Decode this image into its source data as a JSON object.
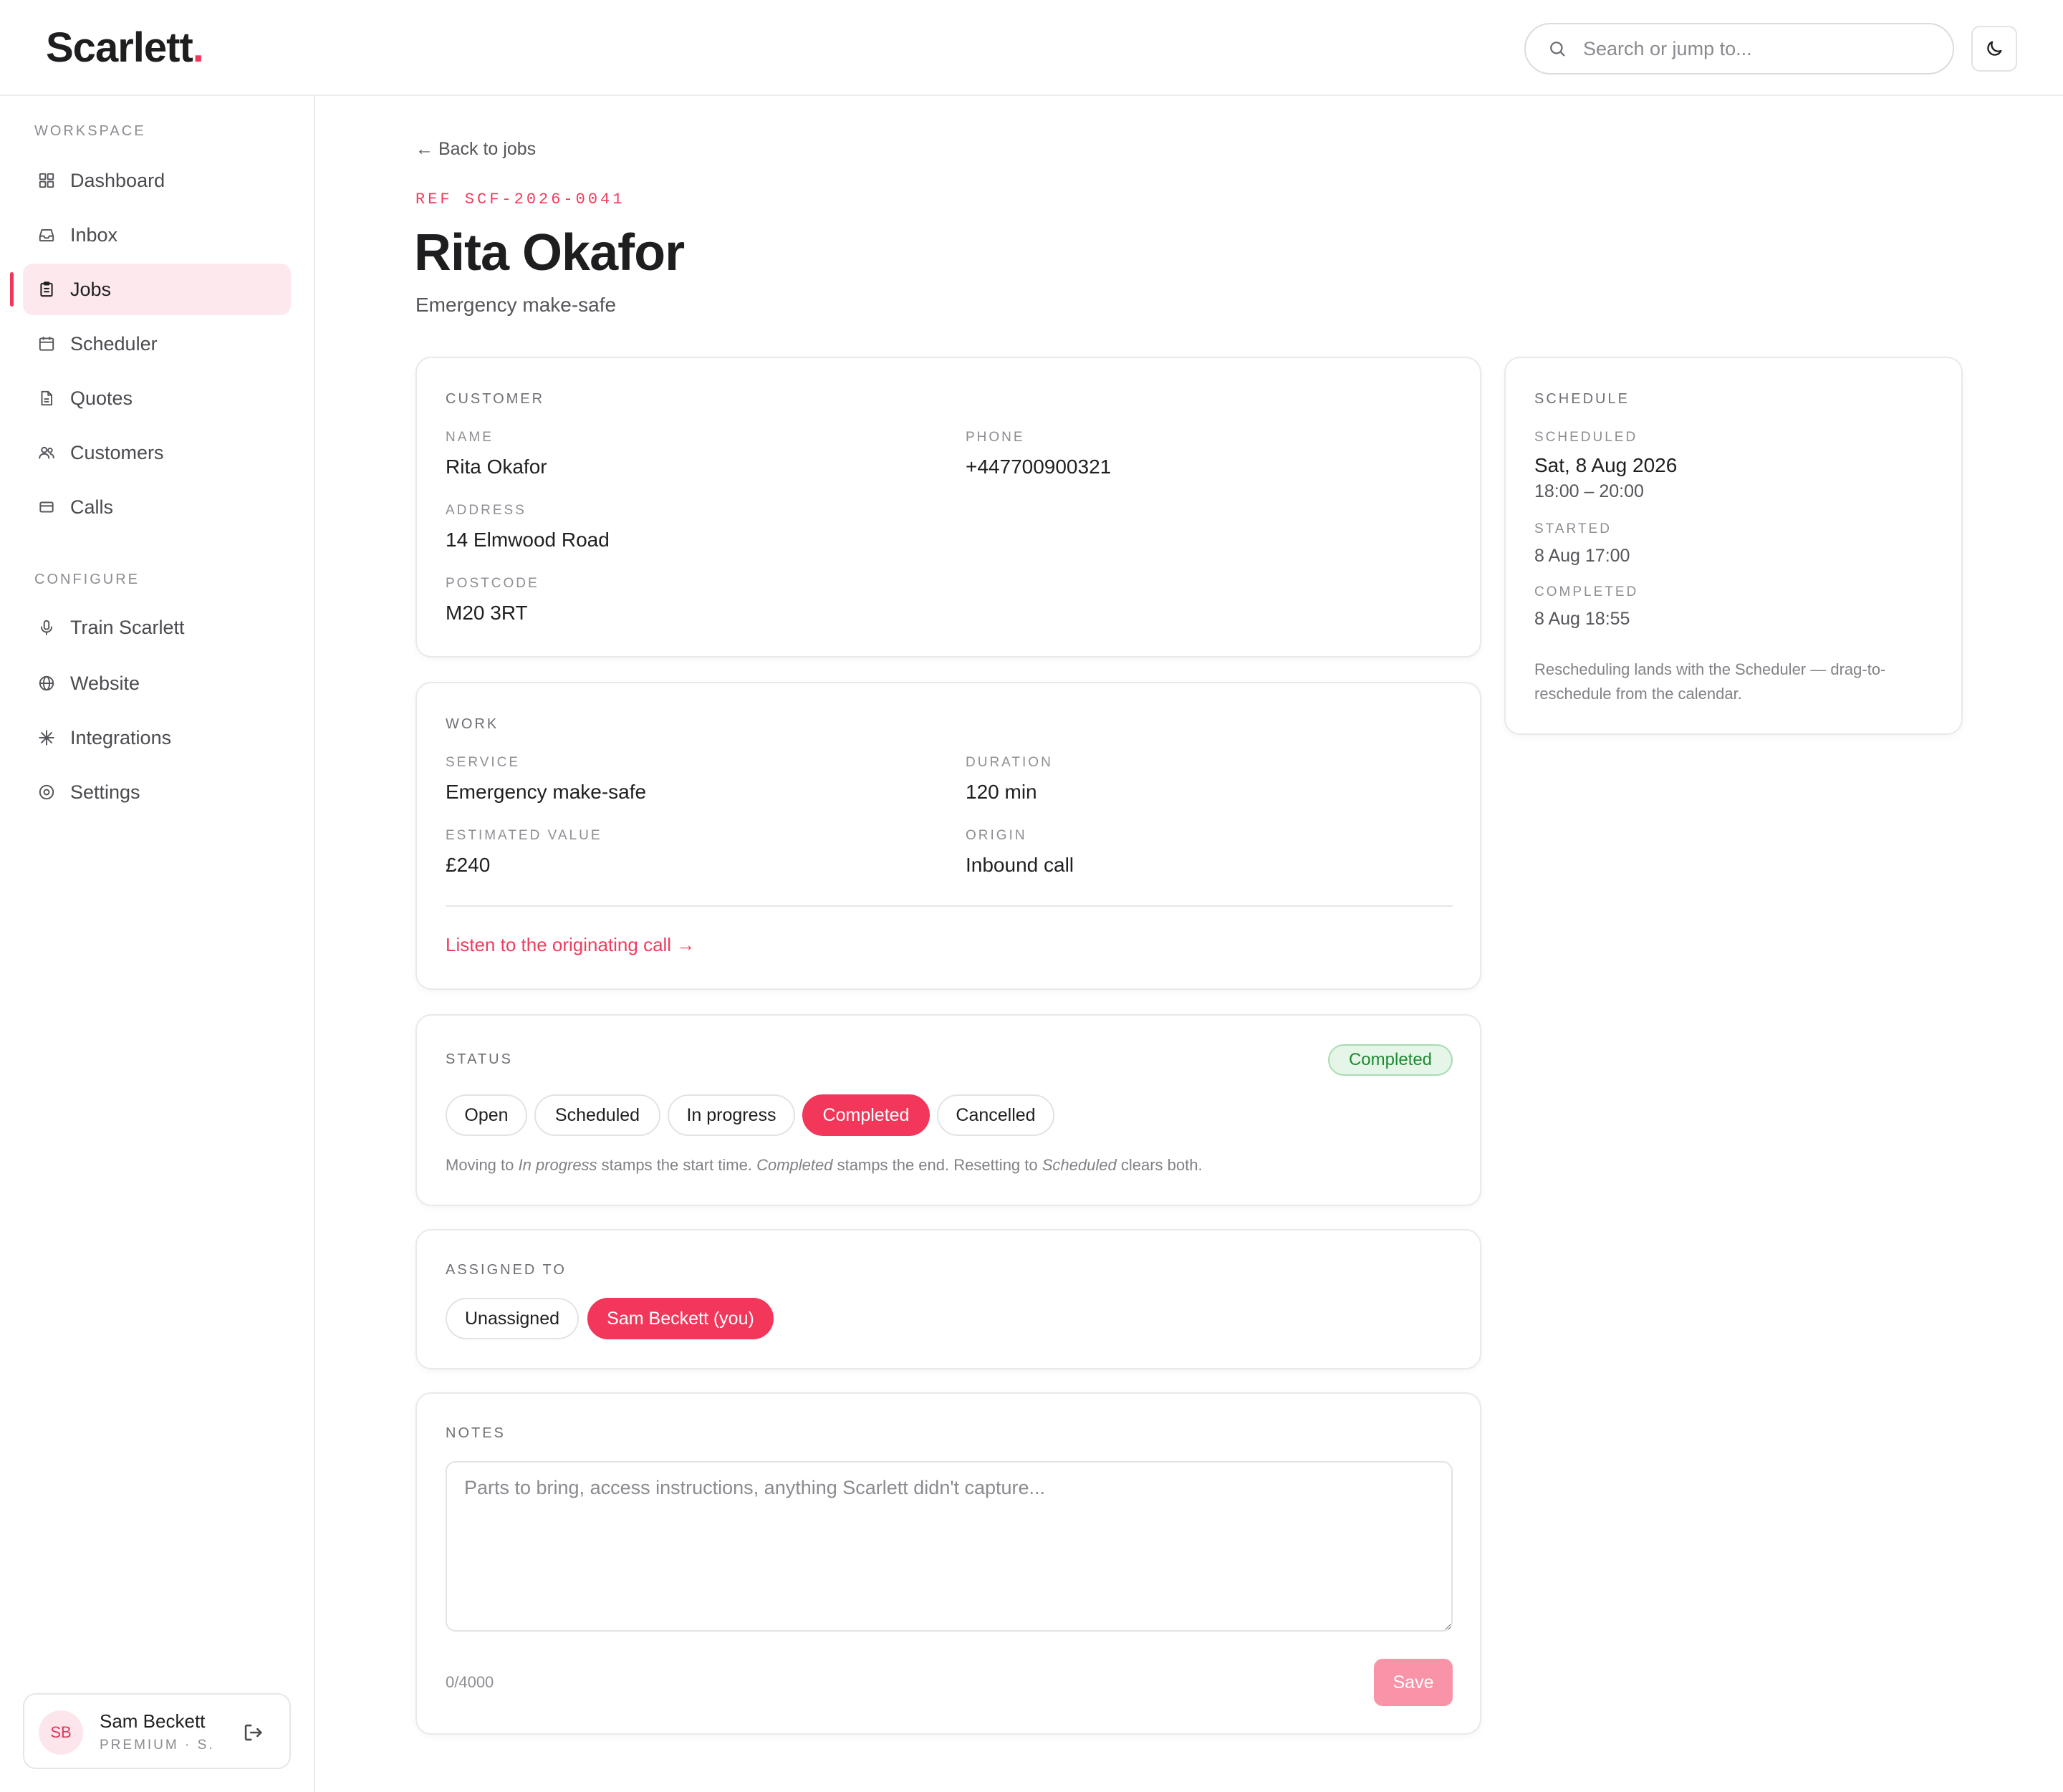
{
  "brand": {
    "name": "Scarlett",
    "dot": ".",
    "accent": "#f0365a"
  },
  "header": {
    "search_placeholder": "Search or jump to...",
    "theme_icon": "moon-icon"
  },
  "sidebar": {
    "workspace_label": "WORKSPACE",
    "configure_label": "CONFIGURE",
    "workspace_items": [
      {
        "label": "Dashboard",
        "icon": "grid-icon"
      },
      {
        "label": "Inbox",
        "icon": "inbox-icon"
      },
      {
        "label": "Jobs",
        "icon": "clipboard-icon",
        "active": true
      },
      {
        "label": "Scheduler",
        "icon": "calendar-icon"
      },
      {
        "label": "Quotes",
        "icon": "document-icon"
      },
      {
        "label": "Customers",
        "icon": "users-icon"
      },
      {
        "label": "Calls",
        "icon": "card-icon"
      }
    ],
    "configure_items": [
      {
        "label": "Train Scarlett",
        "icon": "microphone-icon"
      },
      {
        "label": "Website",
        "icon": "globe-icon"
      },
      {
        "label": "Integrations",
        "icon": "sparkle-icon"
      },
      {
        "label": "Settings",
        "icon": "settings-icon"
      }
    ],
    "user": {
      "initials": "SB",
      "name": "Sam Beckett",
      "plan": "PREMIUM · S..."
    }
  },
  "page": {
    "back_label": "← Back to jobs",
    "ref": "REF SCF-2026-0041",
    "title": "Rita Okafor",
    "subtitle": "Emergency make-safe"
  },
  "customer": {
    "title": "CUSTOMER",
    "name_label": "NAME",
    "name": "Rita Okafor",
    "phone_label": "PHONE",
    "phone": "+447700900321",
    "address_label": "ADDRESS",
    "address": "14 Elmwood Road",
    "postcode_label": "POSTCODE",
    "postcode": "M20 3RT"
  },
  "work": {
    "title": "WORK",
    "service_label": "SERVICE",
    "service": "Emergency make-safe",
    "duration_label": "DURATION",
    "duration": "120 min",
    "value_label": "ESTIMATED VALUE",
    "value": "£240",
    "origin_label": "ORIGIN",
    "origin": "Inbound call",
    "call_link": "Listen to the originating call →"
  },
  "status": {
    "title": "STATUS",
    "current": "Completed",
    "options": [
      "Open",
      "Scheduled",
      "In progress",
      "Completed",
      "Cancelled"
    ],
    "hint": {
      "p1": "Moving to ",
      "e1": "In progress",
      "p2": " stamps the start time. ",
      "e2": "Completed",
      "p3": " stamps the end. Resetting to ",
      "e3": "Scheduled",
      "p4": " clears both."
    },
    "badge_color": "#1d8a32"
  },
  "assigned": {
    "title": "ASSIGNED TO",
    "options": [
      "Unassigned",
      "Sam Beckett (you)"
    ],
    "selected": "Sam Beckett (you)"
  },
  "notes": {
    "title": "NOTES",
    "placeholder": "Parts to bring, access instructions, anything Scarlett didn't capture...",
    "value": "",
    "counter": "0/4000",
    "save_label": "Save"
  },
  "schedule": {
    "title": "SCHEDULE",
    "scheduled_label": "SCHEDULED",
    "scheduled_date": "Sat, 8 Aug 2026",
    "scheduled_time": "18:00 – 20:00",
    "started_label": "STARTED",
    "started": "8 Aug 17:00",
    "completed_label": "COMPLETED",
    "completed": "8 Aug 18:55",
    "note": "Rescheduling lands with the Scheduler — drag-to-reschedule from the calendar."
  }
}
